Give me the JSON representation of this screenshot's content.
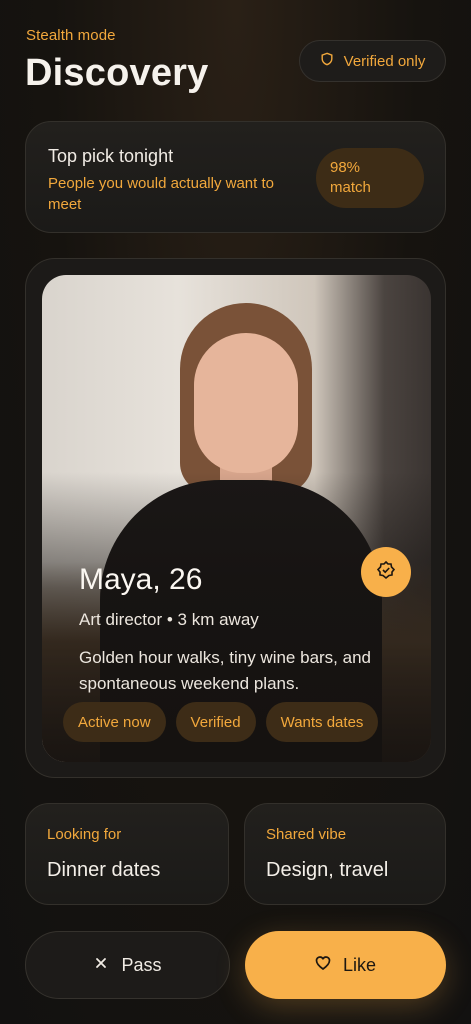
{
  "header": {
    "eyebrow": "Stealth mode",
    "title": "Discovery",
    "filter_label": "Verified only",
    "filter_icon": "shield-icon"
  },
  "top_pick": {
    "title": "Top pick tonight",
    "subtitle": "People you would actually want to meet",
    "match_line1": "98%",
    "match_line2": "match"
  },
  "profile": {
    "name_age": "Maya, 26",
    "job_distance": "Art director • 3 km away",
    "bio": "Golden hour walks, tiny wine bars, and spontaneous weekend plans.",
    "badge_icon": "verified-badge-icon",
    "tags": [
      "Active now",
      "Verified",
      "Wants dates"
    ]
  },
  "info": {
    "looking_for_label": "Looking for",
    "looking_for_value": "Dinner dates",
    "shared_vibe_label": "Shared vibe",
    "shared_vibe_value": "Design, travel"
  },
  "actions": {
    "pass_label": "Pass",
    "pass_icon": "close-icon",
    "like_label": "Like",
    "like_icon": "heart-icon"
  },
  "colors": {
    "accent": "#f2a83c",
    "button_accent": "#f8b04a",
    "background": "#16130f"
  }
}
